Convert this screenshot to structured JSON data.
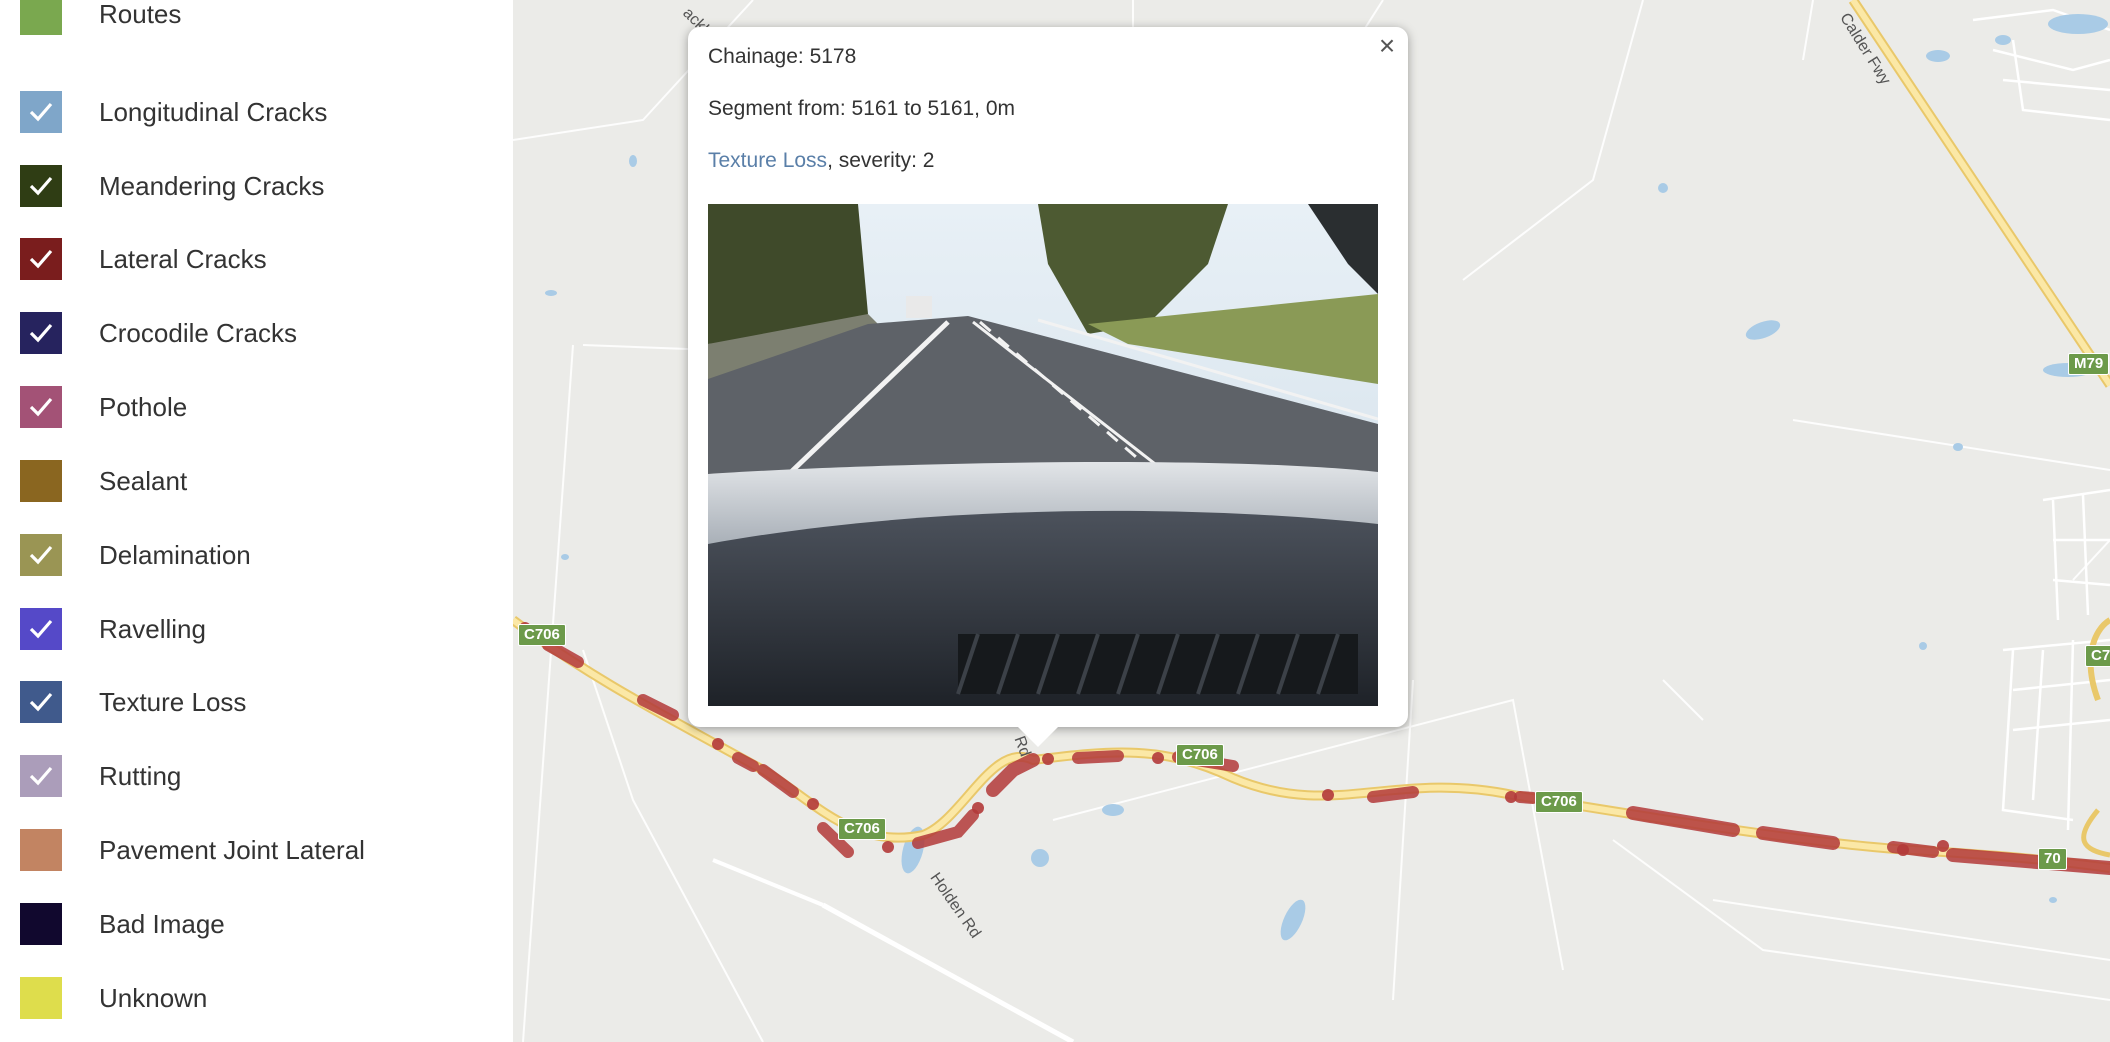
{
  "legend": {
    "items": [
      {
        "label": "Routes",
        "color": "#7aa84f",
        "checked": false
      },
      {
        "label": "Longitudinal Cracks",
        "color": "#7fa6c9",
        "checked": true
      },
      {
        "label": "Meandering Cracks",
        "color": "#2f3d14",
        "checked": true
      },
      {
        "label": "Lateral Cracks",
        "color": "#7a1d1d",
        "checked": true
      },
      {
        "label": "Crocodile Cracks",
        "color": "#26235e",
        "checked": true
      },
      {
        "label": "Pothole",
        "color": "#a35276",
        "checked": true
      },
      {
        "label": "Sealant",
        "color": "#8a6620",
        "checked": false
      },
      {
        "label": "Delamination",
        "color": "#9a9554",
        "checked": true
      },
      {
        "label": "Ravelling",
        "color": "#5549c8",
        "checked": true
      },
      {
        "label": "Texture Loss",
        "color": "#405a8c",
        "checked": true
      },
      {
        "label": "Rutting",
        "color": "#ab9dba",
        "checked": true
      },
      {
        "label": "Pavement Joint Lateral",
        "color": "#c28462",
        "checked": false
      },
      {
        "label": "Bad Image",
        "color": "#11082e",
        "checked": false
      },
      {
        "label": "Unknown",
        "color": "#dedd4c",
        "checked": false
      }
    ]
  },
  "map": {
    "shields": [
      "C706",
      "C706",
      "C706",
      "C706",
      "C7",
      "M79",
      "70"
    ],
    "road_labels": [
      "Holden Rd",
      "Calder Fwy",
      "Rd",
      "ackh"
    ]
  },
  "popup": {
    "close_symbol": "×",
    "chainage": "Chainage: 5178",
    "segment": "Segment from: 5161 to 5161, 0m",
    "defect_link": "Texture Loss",
    "severity": ", severity: 2"
  }
}
